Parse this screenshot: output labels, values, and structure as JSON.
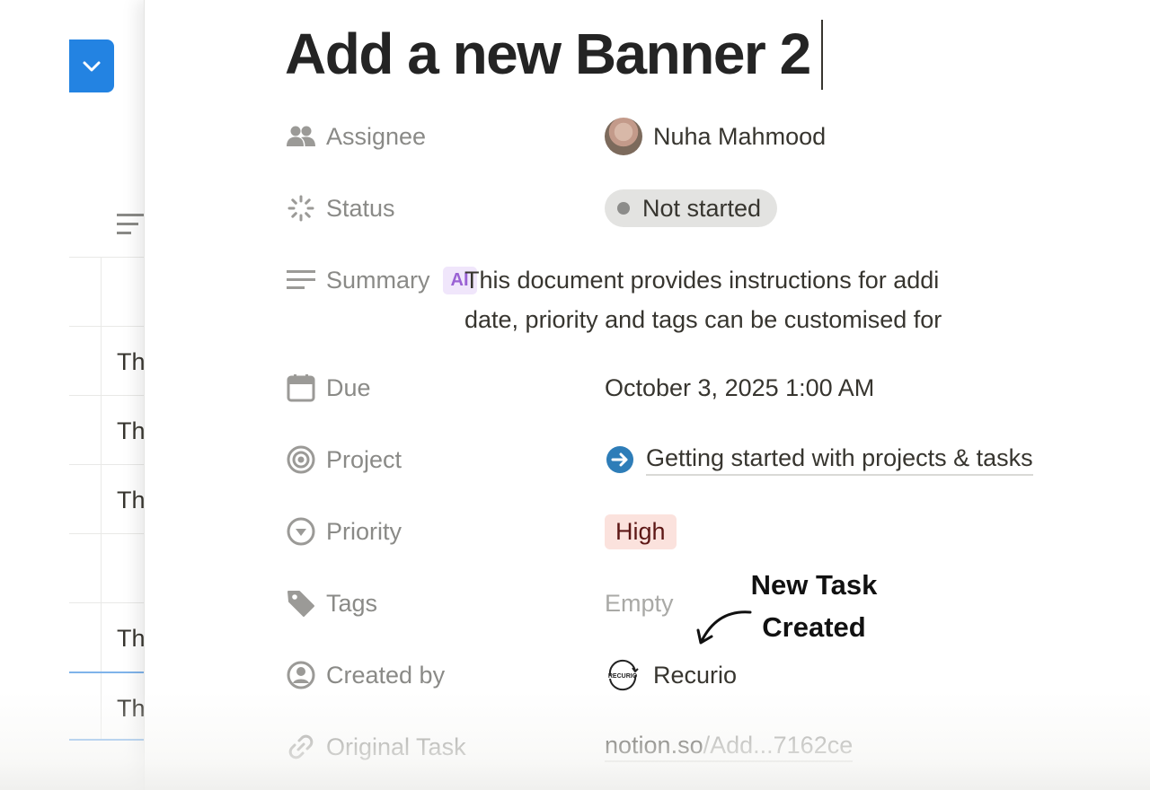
{
  "background_table": {
    "rows": [
      {
        "cell": ""
      },
      {
        "cell": "Th"
      },
      {
        "cell": "Th"
      },
      {
        "cell": "Th"
      },
      {
        "cell": ""
      },
      {
        "cell": "Th"
      },
      {
        "cell": "Th"
      }
    ]
  },
  "page": {
    "title": "Add a new Banner 2"
  },
  "properties": {
    "assignee": {
      "label": "Assignee",
      "icon": "people-icon",
      "value": "Nuha Mahmood"
    },
    "status": {
      "label": "Status",
      "icon": "status-spinner-icon",
      "value": "Not started"
    },
    "summary": {
      "label": "Summary",
      "icon": "text-lines-icon",
      "badge": "AI",
      "line1": "This document provides instructions for addi",
      "line2": "date, priority and tags can be customised for"
    },
    "due": {
      "label": "Due",
      "icon": "calendar-icon",
      "value": "October 3, 2025 1:00 AM"
    },
    "project": {
      "label": "Project",
      "icon": "target-icon",
      "value": "Getting started with projects & tasks"
    },
    "priority": {
      "label": "Priority",
      "icon": "chevron-circle-icon",
      "value": "High"
    },
    "tags": {
      "label": "Tags",
      "icon": "tag-icon",
      "value": "Empty"
    },
    "created_by": {
      "label": "Created by",
      "icon": "user-circle-icon",
      "value": "Recurio",
      "logo_text": "RECURIO"
    },
    "original_task": {
      "label": "Original Task",
      "icon": "link-icon",
      "host": "notion.so",
      "path": "/Add...7162ce"
    }
  },
  "annotation": {
    "line1": "New Task",
    "line2": "Created"
  },
  "colors": {
    "accent": "#2383e2",
    "status_pill": "#e3e3e1",
    "priority_high_bg": "#fbe2dd",
    "ai_badge_bg": "#f0e6fb",
    "project_arrow": "#2e7db8"
  }
}
